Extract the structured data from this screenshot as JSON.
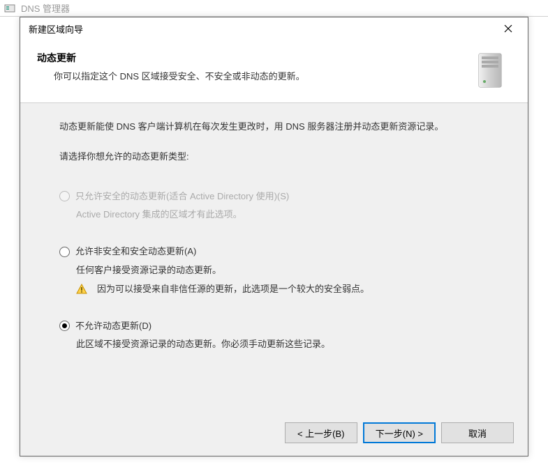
{
  "background": {
    "window_title": "DNS 管理器"
  },
  "dialog": {
    "title": "新建区域向导",
    "heading": "动态更新",
    "subheading": "你可以指定这个 DNS 区域接受安全、不安全或非动态的更新。"
  },
  "body": {
    "intro": "动态更新能使 DNS 客户端计算机在每次发生更改时，用 DNS 服务器注册并动态更新资源记录。",
    "choose_label": "请选择你想允许的动态更新类型:"
  },
  "options": {
    "opt1": {
      "label": "只允许安全的动态更新(适合 Active Directory 使用)(S)",
      "description": "Active Directory 集成的区域才有此选项。"
    },
    "opt2": {
      "label": "允许非安全和安全动态更新(A)",
      "description": "任何客户接受资源记录的动态更新。",
      "warning": "因为可以接受来自非信任源的更新，此选项是一个较大的安全弱点。"
    },
    "opt3": {
      "label": "不允许动态更新(D)",
      "description": "此区域不接受资源记录的动态更新。你必须手动更新这些记录。"
    }
  },
  "buttons": {
    "back": "< 上一步(B)",
    "next": "下一步(N) >",
    "cancel": "取消"
  }
}
